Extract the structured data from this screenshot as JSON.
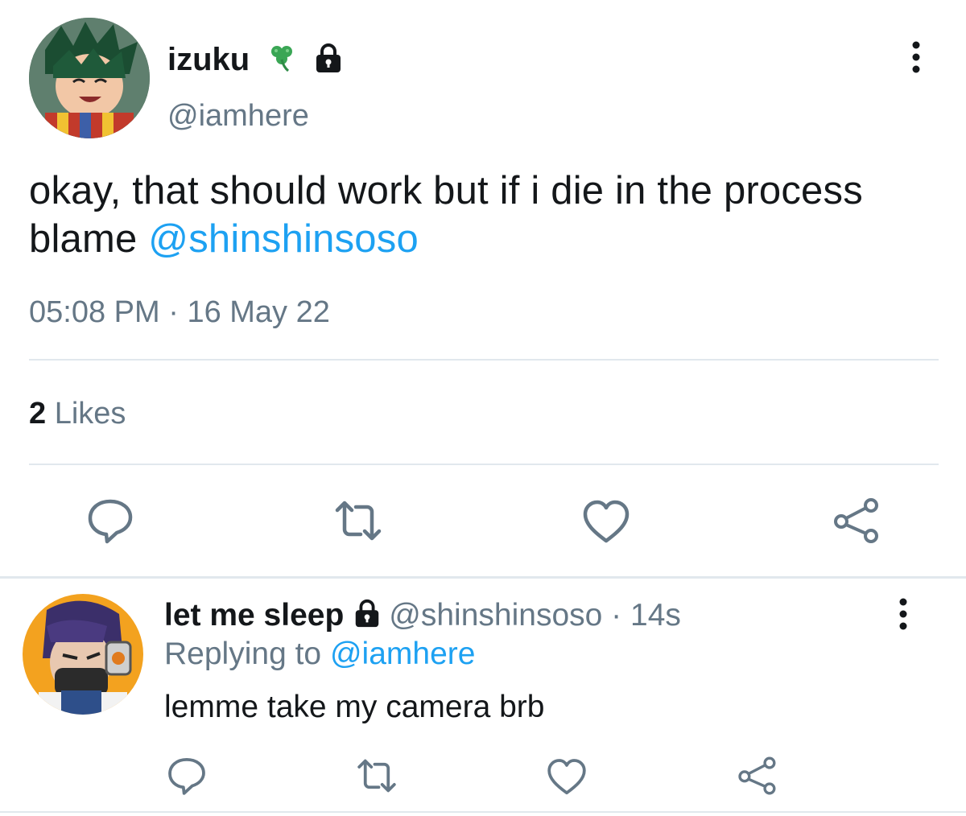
{
  "tweet": {
    "display_name": "izuku",
    "name_emoji": "clover-icon",
    "handle": "@iamhere",
    "text": "okay, that should work but if i die in the process blame ",
    "mention": "@shinshinsoso",
    "time": "05:08 PM",
    "date": "16 May 22",
    "likes_count": "2",
    "likes_label": "Likes",
    "actions": [
      "reply-icon",
      "retweet-icon",
      "like-icon",
      "share-icon"
    ]
  },
  "reply": {
    "display_name": "let me sleep",
    "handle": "@shinshinsoso",
    "age": "14s",
    "replying_label": "Replying to",
    "replying_handle": "@iamhere",
    "text": "lemme take my camera brb",
    "actions": [
      "reply-icon",
      "retweet-icon",
      "like-icon",
      "share-icon"
    ]
  },
  "colors": {
    "link": "#1da1f2",
    "secondary_text": "#657786",
    "icon": "#657786",
    "divider": "#e1e8ed"
  }
}
